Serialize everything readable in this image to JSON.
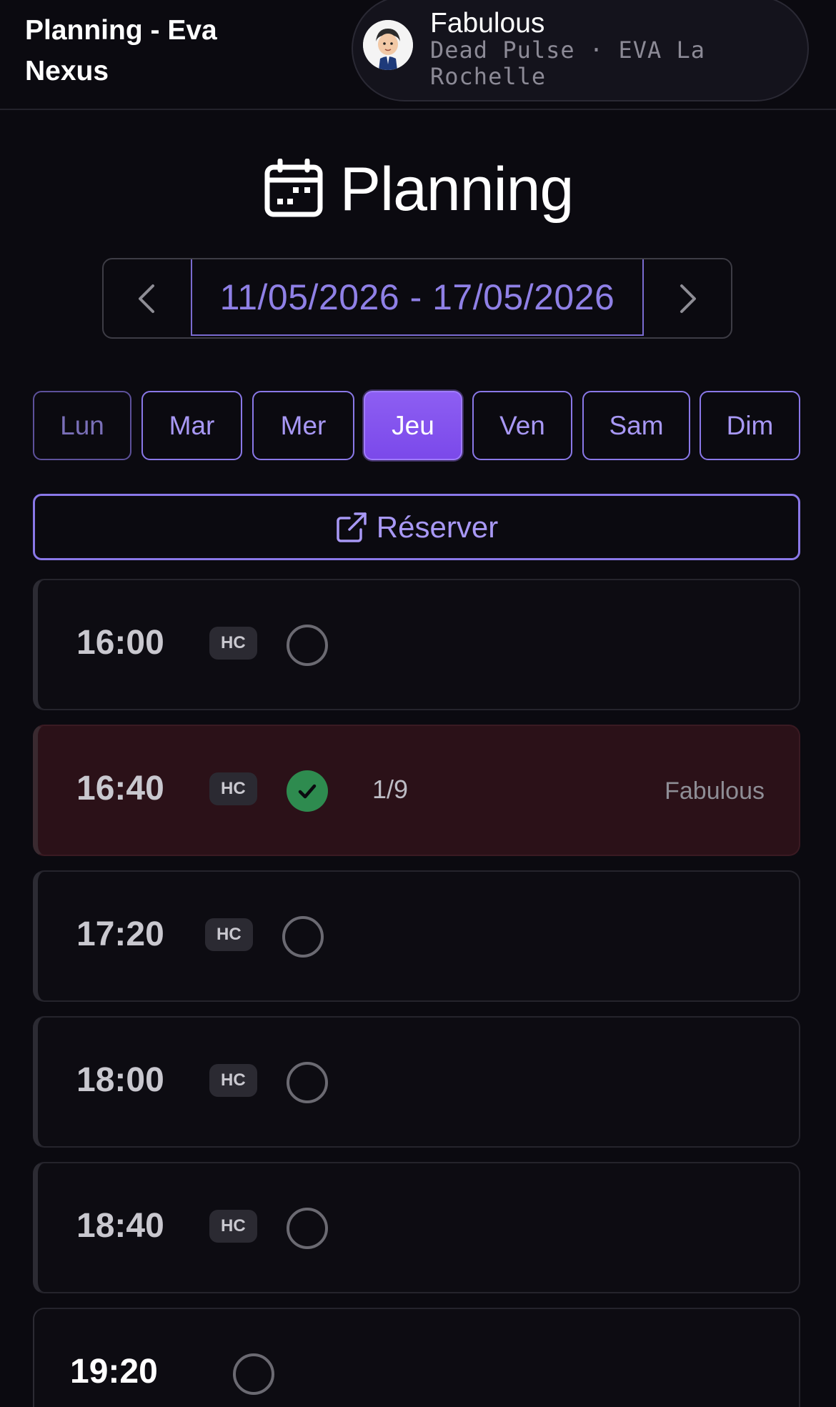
{
  "header": {
    "title": "Planning - Eva Nexus",
    "user_name": "Fabulous",
    "user_subtitle": "Dead Pulse · EVA La Rochelle"
  },
  "page": {
    "title": "Planning",
    "icon": "calendar-icon"
  },
  "week": {
    "range": "11/05/2026 - 17/05/2026",
    "prev_icon": "chevron-left-icon",
    "next_icon": "chevron-right-icon"
  },
  "days": [
    {
      "label": "Lun",
      "state": "muted"
    },
    {
      "label": "Mar",
      "state": "normal"
    },
    {
      "label": "Mer",
      "state": "normal"
    },
    {
      "label": "Jeu",
      "state": "active"
    },
    {
      "label": "Ven",
      "state": "normal"
    },
    {
      "label": "Sam",
      "state": "normal"
    },
    {
      "label": "Dim",
      "state": "normal"
    }
  ],
  "reserve": {
    "label": "Réserver",
    "icon": "external-link-icon"
  },
  "slots": [
    {
      "time": "16:00",
      "badge": "HC",
      "status": "empty"
    },
    {
      "time": "16:40",
      "badge": "HC",
      "status": "booked",
      "count": "1/9",
      "user": "Fabulous"
    },
    {
      "time": "17:20",
      "badge": "HC",
      "status": "empty"
    },
    {
      "time": "18:00",
      "badge": "HC",
      "status": "empty"
    },
    {
      "time": "18:40",
      "badge": "HC",
      "status": "empty"
    },
    {
      "time": "19:20",
      "badge": "",
      "status": "empty"
    }
  ],
  "colors": {
    "background": "#0b0a10",
    "accent": "#8a78e8",
    "active_day": "#8257ef",
    "booked_slot": "#2b1118",
    "check_green": "#2e8b4f"
  }
}
